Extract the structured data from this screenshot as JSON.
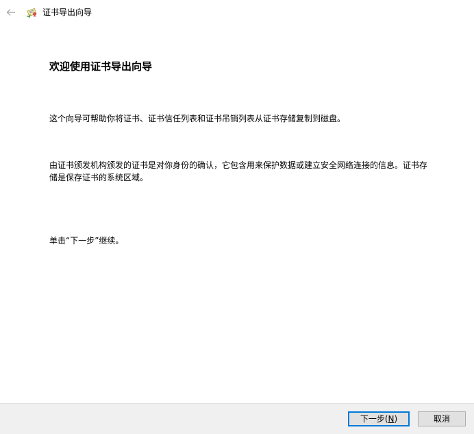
{
  "window": {
    "title": "证书导出向导",
    "back_icon": "arrow-left-icon",
    "wizard_icon": "certificate-icon"
  },
  "content": {
    "heading": "欢迎使用证书导出向导",
    "paragraph1": "这个向导可帮助你将证书、证书信任列表和证书吊销列表从证书存储复制到磁盘。",
    "paragraph2": "由证书颁发机构颁发的证书是对你身份的确认，它包含用来保护数据或建立安全网络连接的信息。证书存储是保存证书的系统区域。",
    "paragraph3": "单击“下一步”继续。"
  },
  "footer": {
    "next_label_prefix": "下一步(",
    "next_label_mnemonic": "N",
    "next_label_suffix": ")",
    "cancel_label": "取消"
  },
  "colors": {
    "footer_bg": "#f0f0f0",
    "focus_border": "#0078d7",
    "button_bg": "#e1e1e1"
  }
}
